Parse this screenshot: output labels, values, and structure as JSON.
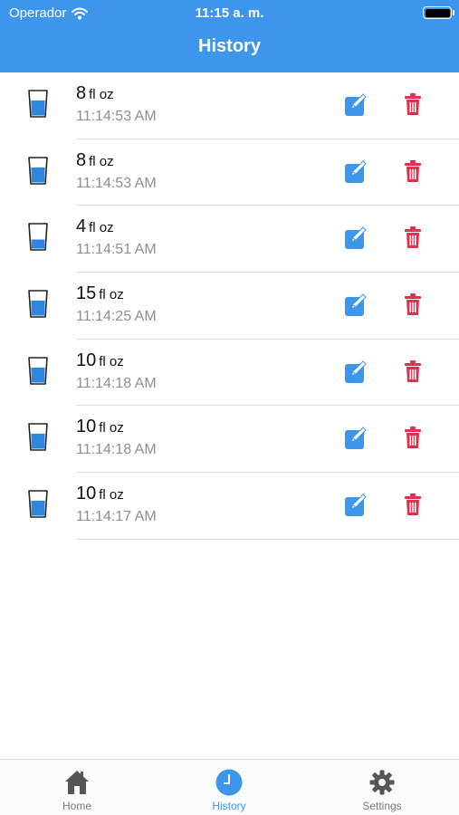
{
  "status_bar": {
    "carrier": "Operador",
    "time": "11:15 a. m."
  },
  "header": {
    "title": "History"
  },
  "entries": [
    {
      "amount": "8",
      "unit": "fl oz",
      "time": "11:14:53 AM",
      "fill": 0.85
    },
    {
      "amount": "8",
      "unit": "fl oz",
      "time": "11:14:53 AM",
      "fill": 0.85
    },
    {
      "amount": "4",
      "unit": "fl oz",
      "time": "11:14:51 AM",
      "fill": 0.5
    },
    {
      "amount": "15",
      "unit": "fl oz",
      "time": "11:14:25 AM",
      "fill": 0.85
    },
    {
      "amount": "10",
      "unit": "fl oz",
      "time": "11:14:18 AM",
      "fill": 0.85
    },
    {
      "amount": "10",
      "unit": "fl oz",
      "time": "11:14:18 AM",
      "fill": 0.85
    },
    {
      "amount": "10",
      "unit": "fl oz",
      "time": "11:14:17 AM",
      "fill": 0.85
    }
  ],
  "tabs": [
    {
      "label": "Home",
      "icon": "home-icon",
      "active": false
    },
    {
      "label": "History",
      "icon": "clock-icon",
      "active": true
    },
    {
      "label": "Settings",
      "icon": "gear-icon",
      "active": false
    }
  ],
  "colors": {
    "accent": "#3d96ec",
    "delete": "#e0304e",
    "water": "#2f86de"
  }
}
